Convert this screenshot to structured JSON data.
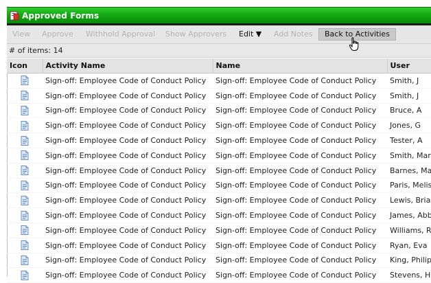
{
  "window": {
    "title": "Approved Forms"
  },
  "toolbar": {
    "view": "View",
    "approve": "Approve",
    "withhold": "Withhold Approval",
    "show_approvers": "Show Approvers",
    "edit": "Edit ▼",
    "add_notes": "Add Notes",
    "back": "Back to Activities"
  },
  "count": {
    "label": "# of items: 14"
  },
  "columns": [
    "Icon",
    "Activity Name",
    "Name",
    "User"
  ],
  "rows": [
    {
      "activity": "Sign-off: Employee Code of Conduct Policy",
      "name": "Sign-off: Employee Code of Conduct Policy",
      "user": "Smith, J"
    },
    {
      "activity": "Sign-off: Employee Code of Conduct Policy",
      "name": "Sign-off: Employee Code of Conduct Policy",
      "user": "Smith, J"
    },
    {
      "activity": "Sign-off: Employee Code of Conduct Policy",
      "name": "Sign-off: Employee Code of Conduct Policy",
      "user": "Bruce, A"
    },
    {
      "activity": "Sign-off: Employee Code of Conduct Policy",
      "name": "Sign-off: Employee Code of Conduct Policy",
      "user": "Jones, G"
    },
    {
      "activity": "Sign-off: Employee Code of Conduct Policy",
      "name": "Sign-off: Employee Code of Conduct Policy",
      "user": "Tester, A"
    },
    {
      "activity": "Sign-off: Employee Code of Conduct Policy",
      "name": "Sign-off: Employee Code of Conduct Policy",
      "user": "Smith, Mar"
    },
    {
      "activity": "Sign-off: Employee Code of Conduct Policy",
      "name": "Sign-off: Employee Code of Conduct Policy",
      "user": "Barnes, Ma"
    },
    {
      "activity": "Sign-off: Employee Code of Conduct Policy",
      "name": "Sign-off: Employee Code of Conduct Policy",
      "user": "Paris, Melis"
    },
    {
      "activity": "Sign-off: Employee Code of Conduct Policy",
      "name": "Sign-off: Employee Code of Conduct Policy",
      "user": "Lewis, Bria"
    },
    {
      "activity": "Sign-off: Employee Code of Conduct Policy",
      "name": "Sign-off: Employee Code of Conduct Policy",
      "user": "James, Abb"
    },
    {
      "activity": "Sign-off: Employee Code of Conduct Policy",
      "name": "Sign-off: Employee Code of Conduct Policy",
      "user": "Williams, R"
    },
    {
      "activity": "Sign-off: Employee Code of Conduct Policy",
      "name": "Sign-off: Employee Code of Conduct Policy",
      "user": "Ryan, Eva"
    },
    {
      "activity": "Sign-off: Employee Code of Conduct Policy",
      "name": "Sign-off: Employee Code of Conduct Policy",
      "user": "King, Philip"
    },
    {
      "activity": "Sign-off: Employee Code of Conduct Policy",
      "name": "Sign-off: Employee Code of Conduct Policy",
      "user": "Stevens, H"
    }
  ],
  "icons": {
    "app": "forms-icon",
    "row": "document-icon",
    "cursor": "hand-pointer-icon"
  },
  "colors": {
    "title_green": "#14a814",
    "toolbar_bg": "#e6e6e6",
    "disabled_text": "#b4b4b4"
  }
}
